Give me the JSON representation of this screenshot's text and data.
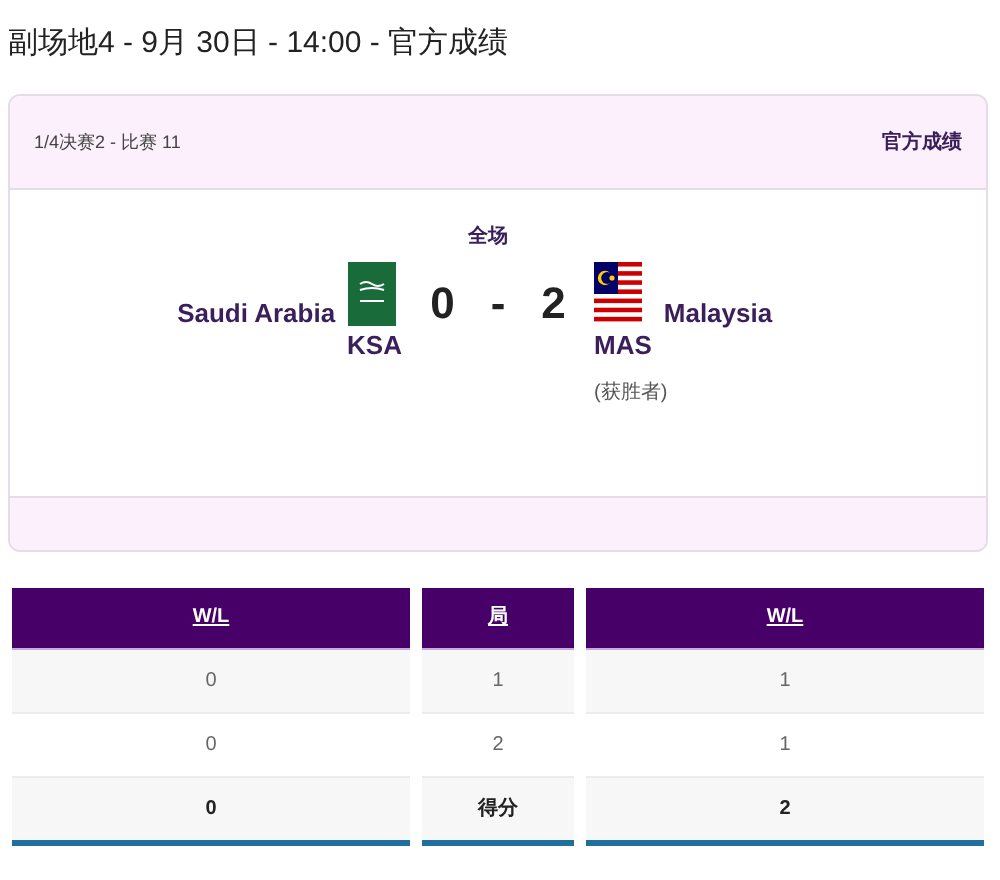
{
  "title": "副场地4 - 9月 30日 - 14:00 - 官方成绩",
  "match": {
    "round": "1/4决赛2 - 比赛 11",
    "status": "官方成绩",
    "period": "全场",
    "home": {
      "name": "Saudi Arabia",
      "code": "KSA",
      "flag": {
        "kind": "ksa"
      }
    },
    "score_home": "0",
    "separator": "-",
    "score_away": "2",
    "away": {
      "name": "Malaysia",
      "code": "MAS",
      "flag": {
        "kind": "mas"
      },
      "winner": true
    },
    "winner_label": "(获胜者)"
  },
  "table": {
    "columns": [
      "W/L",
      "局",
      "W/L"
    ],
    "rows": [
      {
        "kind": "set",
        "cells": [
          "0",
          "1",
          "1"
        ]
      },
      {
        "kind": "set",
        "cells": [
          "0",
          "2",
          "1"
        ]
      },
      {
        "kind": "total",
        "cells": [
          "0",
          "得分",
          "2"
        ]
      }
    ]
  }
}
